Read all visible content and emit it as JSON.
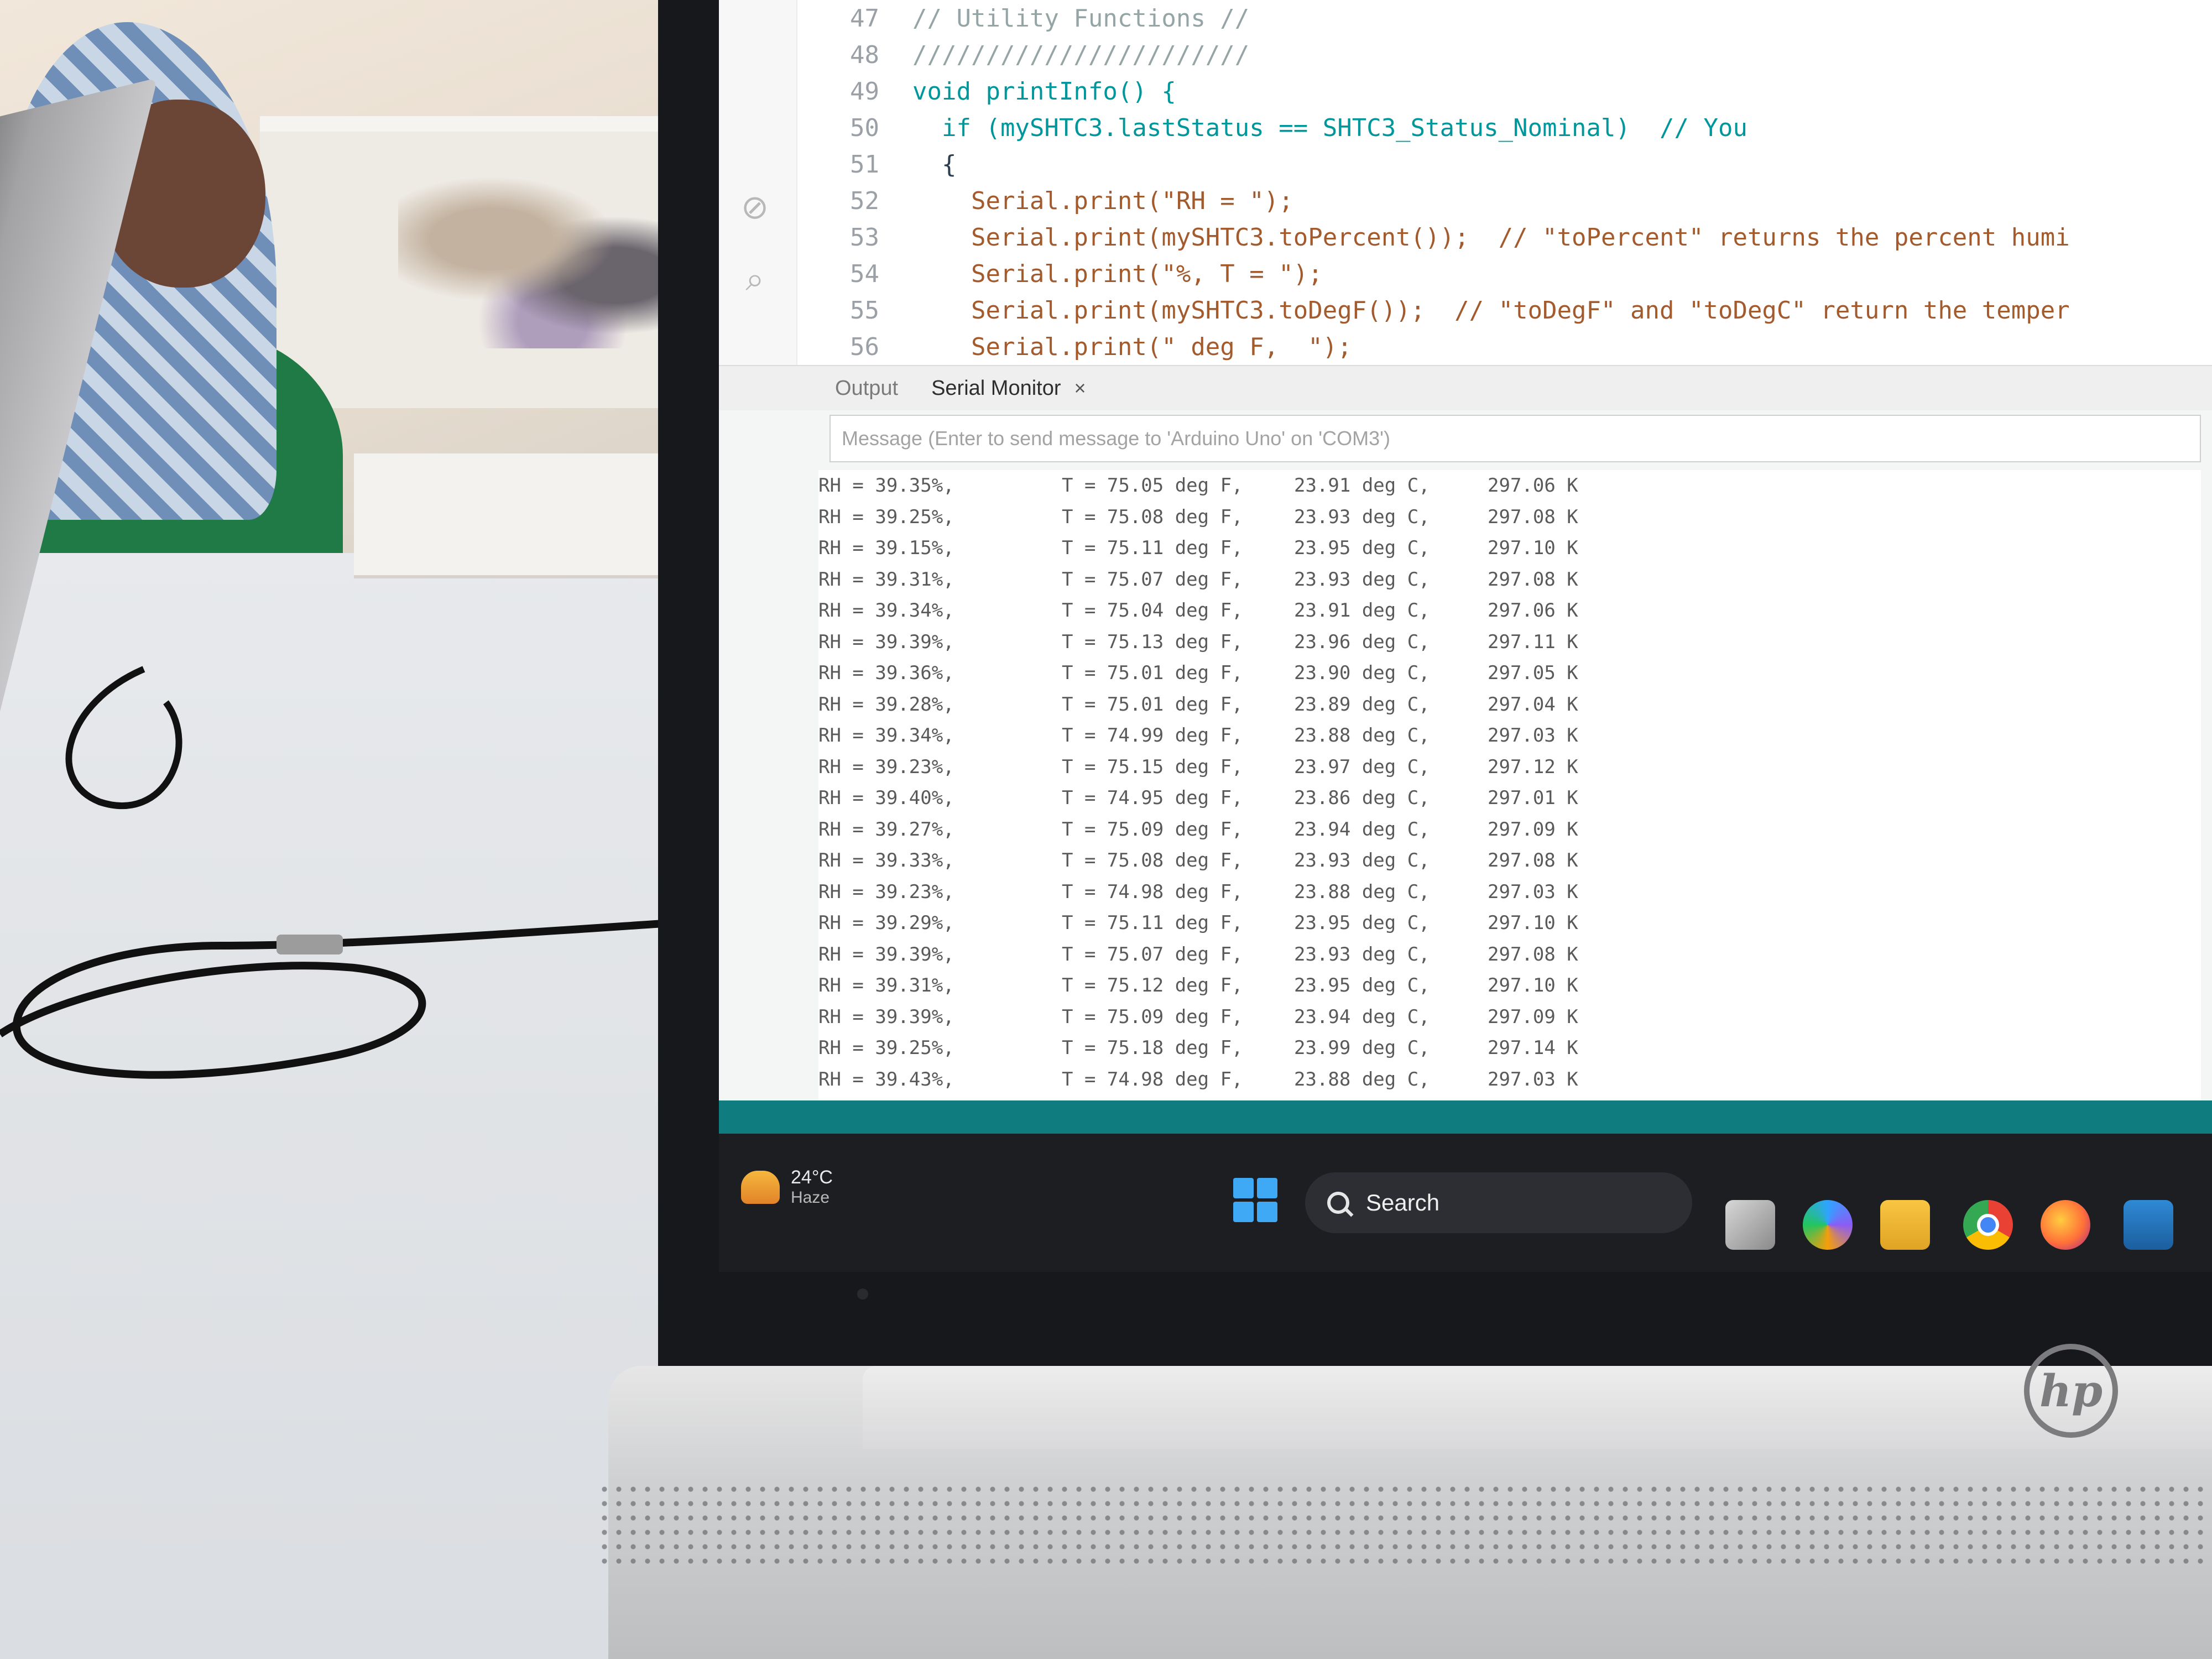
{
  "editor": {
    "lines": [
      {
        "num": "47",
        "text": "// Utility Functions //",
        "kind": "cmt"
      },
      {
        "num": "48",
        "text": "///////////////////////",
        "kind": "cmt"
      },
      {
        "num": "49",
        "text": "void printInfo() {",
        "kind": "kw"
      },
      {
        "num": "50",
        "text": "  if (mySHTC3.lastStatus == SHTC3_Status_Nominal)  // You",
        "kind": "kw"
      },
      {
        "num": "51",
        "text": "  {",
        "kind": "plain"
      },
      {
        "num": "52",
        "text": "    Serial.print(\"RH = \");",
        "kind": "str"
      },
      {
        "num": "53",
        "text": "    Serial.print(mySHTC3.toPercent());  // \"toPercent\" returns the percent humi",
        "kind": "str"
      },
      {
        "num": "54",
        "text": "    Serial.print(\"%, T = \");",
        "kind": "str"
      },
      {
        "num": "55",
        "text": "    Serial.print(mySHTC3.toDegF());  // \"toDegF\" and \"toDegC\" return the temper",
        "kind": "str"
      },
      {
        "num": "56",
        "text": "    Serial.print(\" deg F,  \");",
        "kind": "str"
      }
    ]
  },
  "panel": {
    "tab_output": "Output",
    "tab_serial": "Serial Monitor",
    "close_glyph": "×",
    "message_placeholder": "Message (Enter to send message to 'Arduino Uno' on 'COM3')"
  },
  "serial_rows": [
    {
      "rh": "RH = 39.35%,",
      "tf": "T = 75.05 deg F,",
      "tc": "23.91 deg C,",
      "tk": "297.06 K"
    },
    {
      "rh": "RH = 39.25%,",
      "tf": "T = 75.08 deg F,",
      "tc": "23.93 deg C,",
      "tk": "297.08 K"
    },
    {
      "rh": "RH = 39.15%,",
      "tf": "T = 75.11 deg F,",
      "tc": "23.95 deg C,",
      "tk": "297.10 K"
    },
    {
      "rh": "RH = 39.31%,",
      "tf": "T = 75.07 deg F,",
      "tc": "23.93 deg C,",
      "tk": "297.08 K"
    },
    {
      "rh": "RH = 39.34%,",
      "tf": "T = 75.04 deg F,",
      "tc": "23.91 deg C,",
      "tk": "297.06 K"
    },
    {
      "rh": "RH = 39.39%,",
      "tf": "T = 75.13 deg F,",
      "tc": "23.96 deg C,",
      "tk": "297.11 K"
    },
    {
      "rh": "RH = 39.36%,",
      "tf": "T = 75.01 deg F,",
      "tc": "23.90 deg C,",
      "tk": "297.05 K"
    },
    {
      "rh": "RH = 39.28%,",
      "tf": "T = 75.01 deg F,",
      "tc": "23.89 deg C,",
      "tk": "297.04 K"
    },
    {
      "rh": "RH = 39.34%,",
      "tf": "T = 74.99 deg F,",
      "tc": "23.88 deg C,",
      "tk": "297.03 K"
    },
    {
      "rh": "RH = 39.23%,",
      "tf": "T = 75.15 deg F,",
      "tc": "23.97 deg C,",
      "tk": "297.12 K"
    },
    {
      "rh": "RH = 39.40%,",
      "tf": "T = 74.95 deg F,",
      "tc": "23.86 deg C,",
      "tk": "297.01 K"
    },
    {
      "rh": "RH = 39.27%,",
      "tf": "T = 75.09 deg F,",
      "tc": "23.94 deg C,",
      "tk": "297.09 K"
    },
    {
      "rh": "RH = 39.33%,",
      "tf": "T = 75.08 deg F,",
      "tc": "23.93 deg C,",
      "tk": "297.08 K"
    },
    {
      "rh": "RH = 39.23%,",
      "tf": "T = 74.98 deg F,",
      "tc": "23.88 deg C,",
      "tk": "297.03 K"
    },
    {
      "rh": "RH = 39.29%,",
      "tf": "T = 75.11 deg F,",
      "tc": "23.95 deg C,",
      "tk": "297.10 K"
    },
    {
      "rh": "RH = 39.39%,",
      "tf": "T = 75.07 deg F,",
      "tc": "23.93 deg C,",
      "tk": "297.08 K"
    },
    {
      "rh": "RH = 39.31%,",
      "tf": "T = 75.12 deg F,",
      "tc": "23.95 deg C,",
      "tk": "297.10 K"
    },
    {
      "rh": "RH = 39.39%,",
      "tf": "T = 75.09 deg F,",
      "tc": "23.94 deg C,",
      "tk": "297.09 K"
    },
    {
      "rh": "RH = 39.25%,",
      "tf": "T = 75.18 deg F,",
      "tc": "23.99 deg C,",
      "tk": "297.14 K"
    },
    {
      "rh": "RH = 39.43%,",
      "tf": "T = 74.98 deg F,",
      "tc": "23.88 deg C,",
      "tk": "297.03 K"
    }
  ],
  "taskbar": {
    "weather_temp": "24°C",
    "weather_condition": "Haze",
    "search_label": "Search",
    "apps": [
      "task-view-icon",
      "copilot-icon",
      "file-explorer-icon",
      "chrome-icon",
      "firefox-icon",
      "store-icon"
    ]
  },
  "brand": {
    "logo": "hp"
  },
  "colors": {
    "status_bar": "#0f7c80",
    "taskbar": "#1c1e22",
    "code_string": "#a35a2c",
    "code_keyword": "#00979c"
  }
}
